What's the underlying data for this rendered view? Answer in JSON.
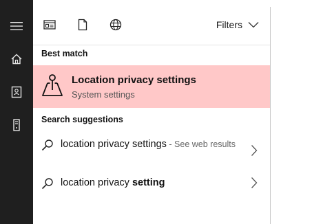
{
  "rail": {
    "items": [
      {
        "icon": "hamburger-menu-icon"
      },
      {
        "icon": "home-icon"
      },
      {
        "icon": "notebook-icon"
      },
      {
        "icon": "tower-device-icon"
      }
    ]
  },
  "toolbar": {
    "icons": [
      "apps-icon",
      "documents-icon",
      "web-globe-icon"
    ],
    "filters_label": "Filters"
  },
  "best_match": {
    "header": "Best match",
    "title": "Location privacy settings",
    "subtitle": "System settings",
    "icon": "location-map-pin-icon",
    "highlight_color": "#ffc8c8"
  },
  "suggestions": {
    "header": "Search suggestions",
    "items": [
      {
        "query": "location privacy settings",
        "hint": " - See web results"
      },
      {
        "query_plain": "location privacy ",
        "query_bold": "setting"
      }
    ]
  }
}
